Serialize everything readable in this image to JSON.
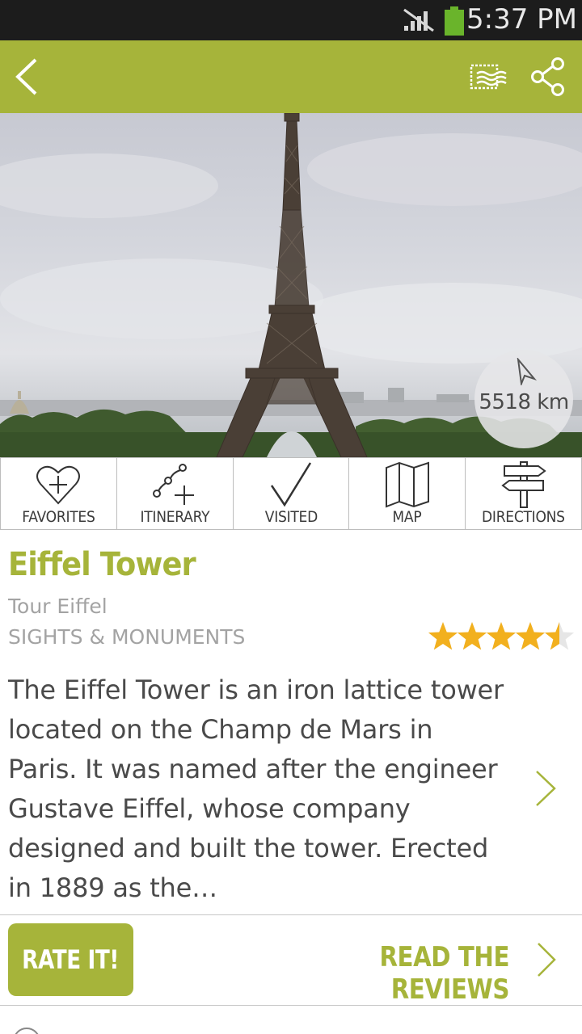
{
  "status_bar": {
    "time": "5:37 PM",
    "icons": [
      "no-signal-icon",
      "battery-icon"
    ]
  },
  "app_bar": {
    "icons": [
      "back-arrow-icon",
      "postcard-icon",
      "share-icon"
    ],
    "accent_color": "#a6b43a"
  },
  "hero": {
    "distance": "5518 km"
  },
  "actions": [
    {
      "label": "FAVORITES",
      "icon": "heart-plus-icon"
    },
    {
      "label": "ITINERARY",
      "icon": "itinerary-icon"
    },
    {
      "label": "VISITED",
      "icon": "checkmark-icon"
    },
    {
      "label": "MAP",
      "icon": "map-icon"
    },
    {
      "label": "DIRECTIONS",
      "icon": "signpost-icon"
    }
  ],
  "place": {
    "name": "Eiffel Tower",
    "local_name": "Tour Eiffel",
    "category": "SIGHTS & MONUMENTS",
    "rating": 4.5,
    "rating_max": 5,
    "description": "The Eiffel Tower is an iron lattice tower located on the Champ de Mars in Paris. It was named after the engineer Gustave Eiffel, whose company designed and built the tower. Erected in 1889 as the…"
  },
  "footer": {
    "rate_label": "RATE IT!",
    "reviews_label": "READ THE REVIEWS"
  },
  "colors": {
    "accent": "#a6b43a",
    "star": "#f2b01e",
    "text": "#4a4a4a",
    "muted": "#a3a3a3"
  }
}
